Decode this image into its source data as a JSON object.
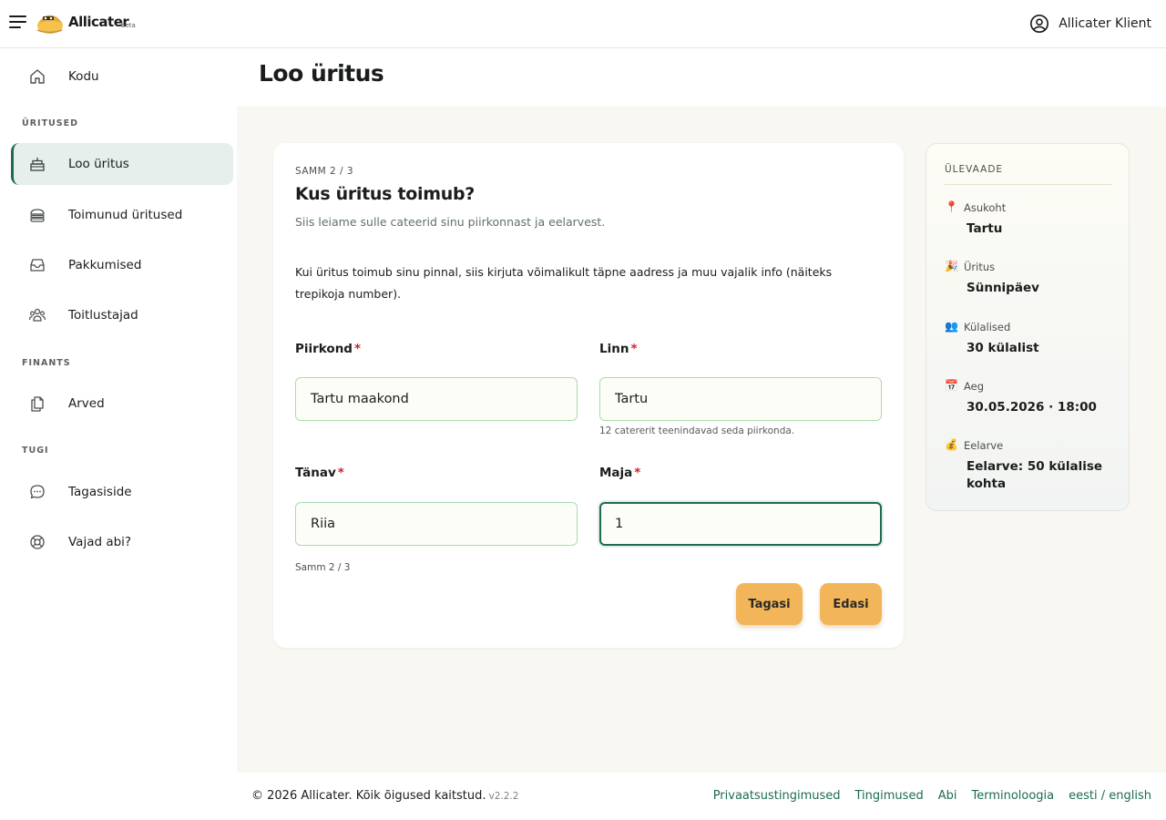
{
  "brand": {
    "name": "Allicater",
    "tag": "beta"
  },
  "user": {
    "name": "Allicater Klient"
  },
  "sidebar": {
    "home": {
      "label": "Kodu",
      "icon": "home-icon"
    },
    "sections": {
      "events": "ÜRITUSED",
      "finance": "FINANTS",
      "support": "TUGI"
    },
    "items": [
      {
        "label": "Loo üritus",
        "icon": "cake-icon",
        "active": true
      },
      {
        "label": "Toimunud üritused",
        "icon": "burger-icon"
      },
      {
        "label": "Pakkumised",
        "icon": "inbox-icon"
      },
      {
        "label": "Toitlustajad",
        "icon": "people-icon"
      },
      {
        "label": "Arved",
        "icon": "documents-icon"
      },
      {
        "label": "Tagasiside",
        "icon": "chat-bubble-icon"
      },
      {
        "label": "Vajad abi?",
        "icon": "lifebuoy-icon"
      }
    ]
  },
  "page": {
    "title": "Loo üritus"
  },
  "form": {
    "step_top": "SAMM 2 / 3",
    "title": "Kus üritus toimub?",
    "subtitle": "Siis leiame sulle cateerid sinu piirkonnast ja eelarvest.",
    "info": "Kui üritus toimub sinu pinnal, siis kirjuta võimalikult täpne aadress ja muu vajalik info (näiteks trepikoja number).",
    "required_mark": "*",
    "fields": {
      "county": {
        "label": "Piirkond",
        "value": "Tartu maakond"
      },
      "city": {
        "label": "Linn",
        "value": "Tartu",
        "hint": "12 catererit teenindavad seda piirkonda."
      },
      "street": {
        "label": "Tänav",
        "value": "Riia"
      },
      "house": {
        "label": "Maja",
        "value": "1"
      }
    },
    "step_bottom": "Samm 2 / 3",
    "buttons": {
      "back": "Tagasi",
      "next": "Edasi"
    }
  },
  "overview": {
    "title": "ÜLEVAADE",
    "rows": [
      {
        "icon": "📍",
        "icon_name": "location-pin-icon",
        "label": "Asukoht",
        "value": "Tartu"
      },
      {
        "icon": "🎉",
        "icon_name": "party-popper-icon",
        "label": "Üritus",
        "value": "Sünnipäev"
      },
      {
        "icon": "👥",
        "icon_name": "guests-icon",
        "label": "Külalised",
        "value": "30 külalist"
      },
      {
        "icon": "📅",
        "icon_name": "calendar-icon",
        "label": "Aeg",
        "value": "30.05.2026 · 18:00"
      },
      {
        "icon": "💰",
        "icon_name": "money-bag-icon",
        "label": "Eelarve",
        "value": "Eelarve: 50 külalise kohta"
      }
    ]
  },
  "footer": {
    "copyright": "© 2026 Allicater. Kõik õigused kaitstud.",
    "version": "v2.2.2",
    "links": [
      "Privaatsustingimused",
      "Tingimused",
      "Abi",
      "Terminoloogia",
      "eesti / english"
    ]
  },
  "colors": {
    "accent": "#1e6b52",
    "button": "#f3b55a",
    "active_nav": "#e6efec",
    "required": "#d1202a",
    "content_bg": "#f8f7f2"
  }
}
